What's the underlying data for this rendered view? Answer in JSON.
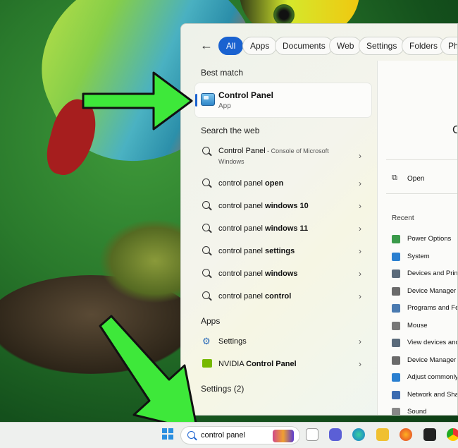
{
  "filters": {
    "back_label": "←",
    "chips": [
      "All",
      "Apps",
      "Documents",
      "Web",
      "Settings",
      "Folders",
      "Pho"
    ]
  },
  "best_match": {
    "heading": "Best match",
    "title": "Control Panel",
    "subtitle": "App"
  },
  "search_web": {
    "heading": "Search the web",
    "first": {
      "title": "Control Panel",
      "suffix": " - Console of Microsoft",
      "suffix2": "Windows"
    },
    "items": [
      {
        "plain": "control panel ",
        "bold": "open"
      },
      {
        "plain": "control panel ",
        "bold": "windows 10"
      },
      {
        "plain": "control panel ",
        "bold": "windows 11"
      },
      {
        "plain": "control panel ",
        "bold": "settings"
      },
      {
        "plain": "control panel ",
        "bold": "windows"
      },
      {
        "plain": "control panel ",
        "bold": "control"
      }
    ]
  },
  "apps": {
    "heading": "Apps",
    "items": [
      {
        "plain": "Settings",
        "bold": ""
      },
      {
        "plain": "NVIDIA ",
        "bold": "Control Panel"
      }
    ]
  },
  "settings_heading": "Settings (2)",
  "preview": {
    "title_fragment": "C",
    "open_label": "Open",
    "recent_heading": "Recent",
    "recent": [
      {
        "label": "Power Options",
        "color": "#3a9a4a"
      },
      {
        "label": "System",
        "color": "#2a7fd0"
      },
      {
        "label": "Devices and Printe",
        "color": "#5a6a7a"
      },
      {
        "label": "Device Manager - ",
        "color": "#6a6a6a"
      },
      {
        "label": "Programs and Fea",
        "color": "#4a7ab0"
      },
      {
        "label": "Mouse",
        "color": "#777777"
      },
      {
        "label": "View devices and",
        "color": "#5a6a7a"
      },
      {
        "label": "Device Manager - ",
        "color": "#6a6a6a"
      },
      {
        "label": "Adjust commonly ",
        "color": "#2a7fd0"
      },
      {
        "label": "Network and Shar",
        "color": "#3a6ab0"
      },
      {
        "label": "Sound",
        "color": "#888888"
      }
    ]
  },
  "taskbar": {
    "search_value": "control panel"
  },
  "colors": {
    "accent": "#1a62d0",
    "arrow": "#3ee83a"
  }
}
